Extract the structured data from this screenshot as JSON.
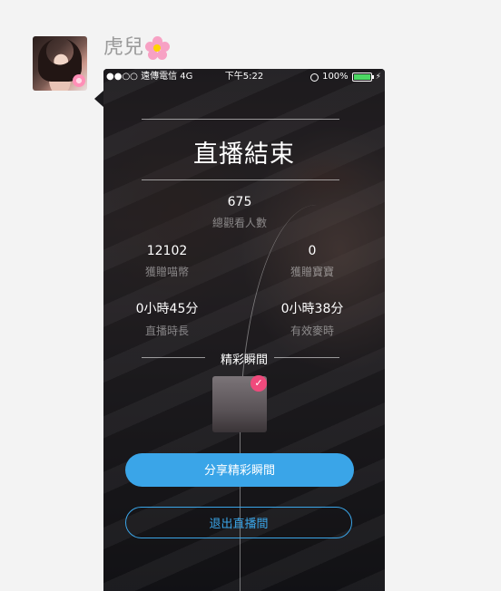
{
  "chat": {
    "sender_name": "虎兒",
    "sender_emoji_icon": "cherry-blossom-icon"
  },
  "statusbar": {
    "carrier": "●●○○ 遠傳電信 4G",
    "time": "下午5:22",
    "battery": "100%"
  },
  "live_end": {
    "title": "直播結束",
    "total_viewers": {
      "value": "675",
      "label": "總觀看人數"
    },
    "coins": {
      "value": "12102",
      "label": "獲贈喵幣"
    },
    "treasures": {
      "value": "0",
      "label": "獲贈寶寶"
    },
    "duration": {
      "value": "0小時45分",
      "label": "直播時長"
    },
    "mic_time": {
      "value": "0小時38分",
      "label": "有效麥時"
    },
    "highlights_label": "精彩瞬間",
    "share_button": "分享精彩瞬間",
    "exit_button": "退出直播間"
  },
  "colors": {
    "accent": "#3aa5e8",
    "check": "#ef4a7c",
    "battery": "#4cd964"
  }
}
